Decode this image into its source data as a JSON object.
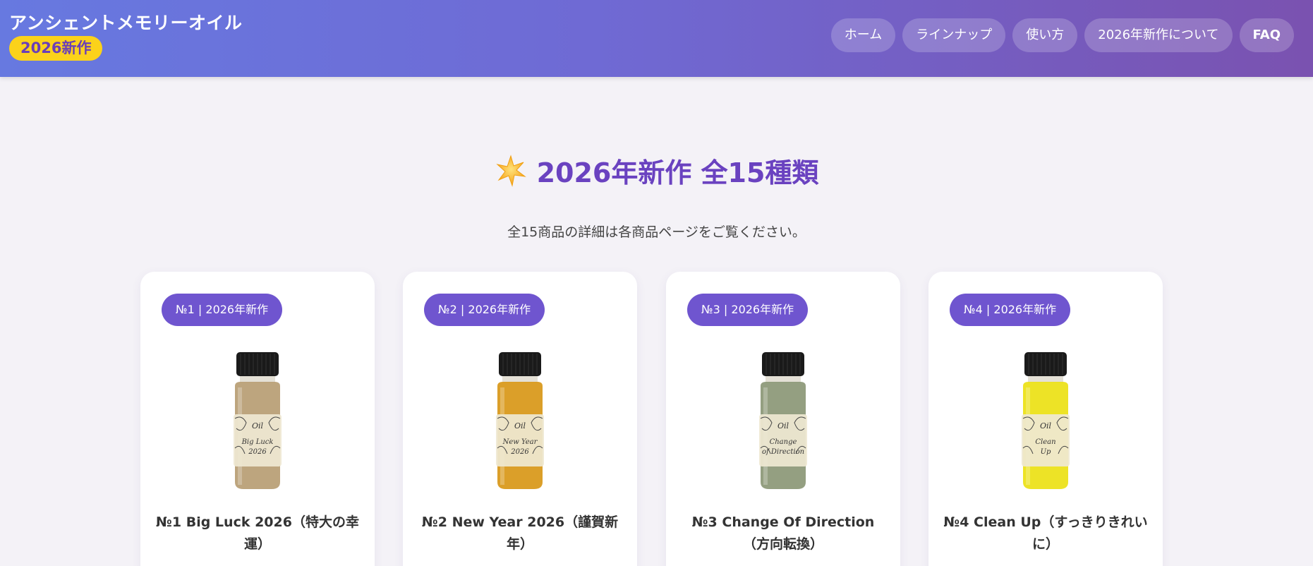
{
  "header": {
    "brand_title": "アンシェントメモリーオイル",
    "brand_badge": "2026新作",
    "nav": [
      {
        "label": "ホーム"
      },
      {
        "label": "ラインナップ"
      },
      {
        "label": "使い方"
      },
      {
        "label": "2026年新作について"
      },
      {
        "label": "FAQ"
      }
    ]
  },
  "main": {
    "section_icon": "sparkle-star-icon",
    "section_title": "2026年新作 全15種類",
    "section_subtitle": "全15商品の詳細は各商品ページをご覧ください。",
    "products": [
      {
        "badge": "№1 | 2026年新作",
        "name": "№1 Big Luck 2026（特大の幸運）",
        "label_line1": "Big Luck",
        "label_line2": "2026",
        "liquid_color": "#b9a077"
      },
      {
        "badge": "№2 | 2026年新作",
        "name": "№2 New Year 2026（謹賀新年）",
        "label_line1": "New Year",
        "label_line2": "2026",
        "liquid_color": "#d99a1e"
      },
      {
        "badge": "№3 | 2026年新作",
        "name": "№3 Change Of Direction（方向転換）",
        "label_line1": "Change",
        "label_line2": "of Direction",
        "liquid_color": "#8e9a7a"
      },
      {
        "badge": "№4 | 2026年新作",
        "name": "№4 Clean Up（すっきりきれいに）",
        "label_line1": "Clean",
        "label_line2": "Up",
        "liquid_color": "#ece21a"
      }
    ]
  },
  "colors": {
    "header_gradient_start": "#6779e0",
    "header_gradient_end": "#7a52b0",
    "accent_purple": "#6f55cf",
    "badge_yellow": "#fbd21a",
    "title_purple": "#6a42c0"
  }
}
